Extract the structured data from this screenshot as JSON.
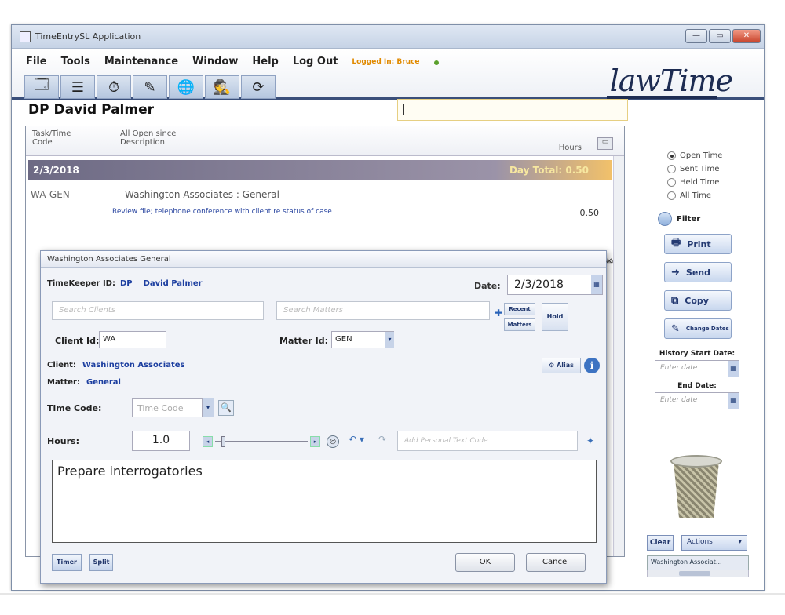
{
  "window": {
    "title": "TimeEntrySL Application"
  },
  "menu": {
    "items": [
      "File",
      "Tools",
      "Maintenance",
      "Window",
      "Help",
      "Log Out"
    ],
    "logged_in": "Logged In: Bruce"
  },
  "logo": "lawTime",
  "page": {
    "title": "DP David Palmer"
  },
  "list": {
    "header": {
      "col1_top": "Task/Time",
      "col1_bottom": "Code",
      "col2_top": "All Open since",
      "col2_bottom": "Description",
      "col3": "Hours"
    },
    "day": {
      "date": "2/3/2018",
      "total": "Day Total: 0.50"
    },
    "entry": {
      "code": "WA-GEN",
      "client": "Washington Associates : General",
      "desc": "Review file; telephone conference with client re status of case",
      "hours": "0.50"
    }
  },
  "right": {
    "radios": [
      "Open Time",
      "Sent Time",
      "Held Time",
      "All Time"
    ],
    "selected_radio": "Open Time",
    "filter": "Filter",
    "buttons": [
      "Print",
      "Send",
      "Copy",
      "Change Dates"
    ],
    "history_start": "History Start Date:",
    "start_placeholder": "Enter date",
    "end_label": "End Date:",
    "end_placeholder": "Enter date",
    "clear": "Clear",
    "actions": "Actions",
    "bottom_tab": "Washington Associat..."
  },
  "dialog": {
    "title": "Washington Associates General",
    "timekeeper_label": "TimeKeeper ID:",
    "timekeeper_id": "DP",
    "timekeeper_name": "David Palmer",
    "date_label": "Date:",
    "date_value": "2/3/2018",
    "search_clients": "Search Clients",
    "search_matters": "Search Matters",
    "recent_btn": "Recent",
    "matters_btn": "Matters",
    "hold_btn": "Hold",
    "client_id_label": "Client Id:",
    "client_id": "WA",
    "matter_id_label": "Matter Id:",
    "matter_id": "GEN",
    "client_label": "Client:",
    "client_name": "Washington Associates",
    "matter_label": "Matter:",
    "matter_name": "General",
    "alias_btn": "Alias",
    "time_code_label": "Time Code:",
    "time_code_placeholder": "Time Code",
    "hours_label": "Hours:",
    "hours_value": "1.0",
    "personal_text_placeholder": "Add Personal Text Code",
    "notes": "Prepare interrogatories",
    "timer_btn": "Timer",
    "split_btn": "Split",
    "ok_btn": "OK",
    "cancel_btn": "Cancel"
  }
}
